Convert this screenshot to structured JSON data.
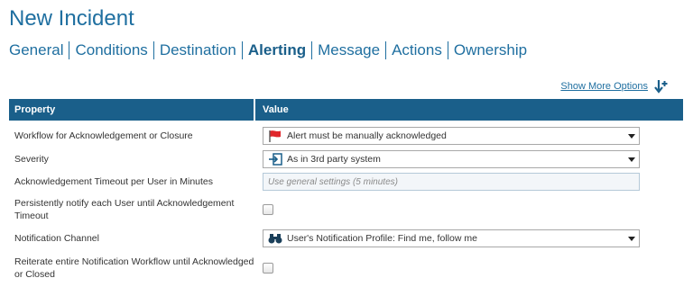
{
  "page_title": "New Incident",
  "tabs": [
    {
      "label": "General",
      "active": false
    },
    {
      "label": "Conditions",
      "active": false
    },
    {
      "label": "Destination",
      "active": false
    },
    {
      "label": "Alerting",
      "active": true
    },
    {
      "label": "Message",
      "active": false
    },
    {
      "label": "Actions",
      "active": false
    },
    {
      "label": "Ownership",
      "active": false
    }
  ],
  "more_options": {
    "label": "Show More Options",
    "icon": "sort-down-plus-icon"
  },
  "table": {
    "col_property": "Property",
    "col_value": "Value",
    "rows": {
      "workflow": {
        "label": "Workflow for Acknowledgement or Closure",
        "value": "Alert must be manually acknowledged",
        "icon": "red-flag-icon"
      },
      "severity": {
        "label": "Severity",
        "value": "As in 3rd party system",
        "icon": "import-arrow-icon"
      },
      "ack_timeout": {
        "label": "Acknowledgement Timeout per User in Minutes",
        "placeholder": "Use general settings (5 minutes)"
      },
      "persist_notify": {
        "label": "Persistently notify each User until Acknowledgement Timeout",
        "checked": false
      },
      "channel": {
        "label": "Notification Channel",
        "value": "User's Notification Profile: Find me, follow me",
        "icon": "binoculars-icon"
      },
      "reiterate": {
        "label": "Reiterate entire Notification Workflow until Acknowledged or Closed",
        "checked": false
      }
    }
  },
  "colors": {
    "accent": "#1f6fa0",
    "header_bg": "#1a5f8a",
    "flag": "#e0262b"
  }
}
